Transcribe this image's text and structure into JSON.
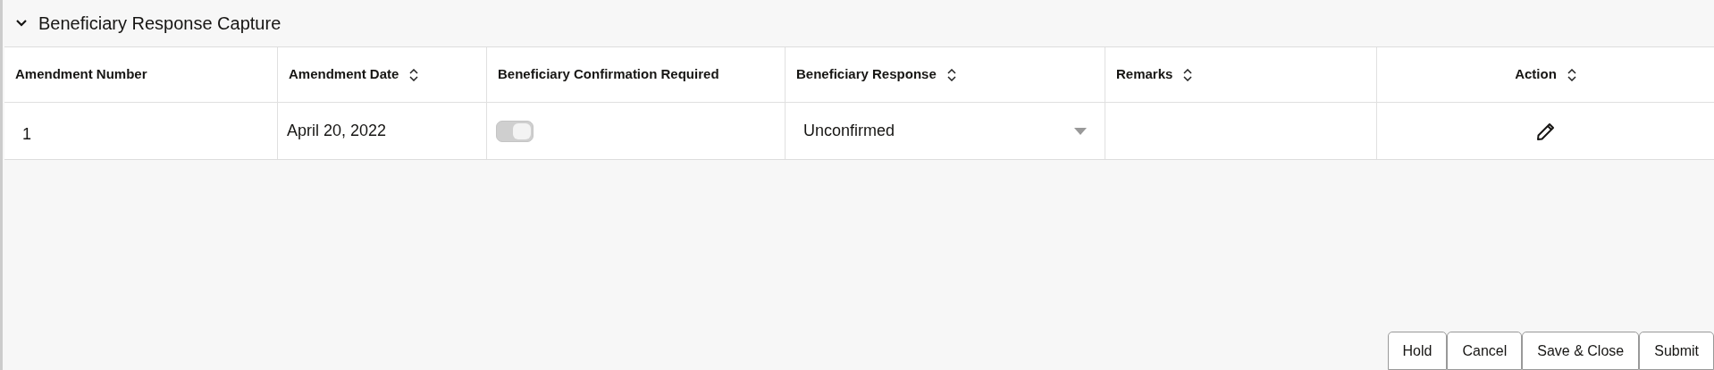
{
  "section": {
    "title": "Beneficiary Response Capture",
    "expanded": true
  },
  "table": {
    "columns": [
      {
        "label": "Amendment Number",
        "sortable": false
      },
      {
        "label": "Amendment Date",
        "sortable": true
      },
      {
        "label": "Beneficiary Confirmation Required",
        "sortable": false
      },
      {
        "label": "Beneficiary Response",
        "sortable": true
      },
      {
        "label": "Remarks",
        "sortable": true
      },
      {
        "label": "Action",
        "sortable": true
      }
    ],
    "rows": [
      {
        "amendment_number": "1",
        "amendment_date": "April 20, 2022",
        "confirmation_required": {
          "on": true,
          "disabled": true
        },
        "response": "Unconfirmed"
      }
    ]
  },
  "buttons": [
    "Hold",
    "Cancel",
    "Save & Close",
    "Submit"
  ]
}
